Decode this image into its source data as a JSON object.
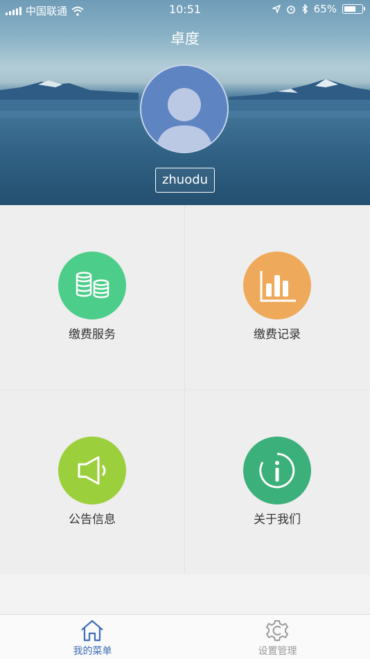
{
  "status_bar": {
    "carrier": "中国联通",
    "time": "10:51",
    "battery_percent": "65%",
    "battery_level": 0.65,
    "icons": [
      "signal-icon",
      "wifi-icon",
      "location-icon",
      "alarm-icon",
      "bluetooth-icon",
      "battery-icon"
    ]
  },
  "header": {
    "title": "卓度",
    "username": "zhuodu",
    "avatar_icon": "user-silhouette-icon"
  },
  "menu": {
    "items": [
      {
        "label": "缴费服务",
        "icon": "coins-icon",
        "color": "#4ccd8a"
      },
      {
        "label": "缴费记录",
        "icon": "bar-chart-icon",
        "color": "#eeaa5a"
      },
      {
        "label": "公告信息",
        "icon": "speaker-icon",
        "color": "#9ccf3c"
      },
      {
        "label": "关于我们",
        "icon": "info-icon",
        "color": "#3cb07a"
      }
    ]
  },
  "tabbar": {
    "tabs": [
      {
        "label": "我的菜单",
        "icon": "home-icon",
        "active": true,
        "color": "#3d6fb6"
      },
      {
        "label": "设置管理",
        "icon": "gear-icon",
        "active": false,
        "color": "#9a9a9a"
      }
    ]
  }
}
